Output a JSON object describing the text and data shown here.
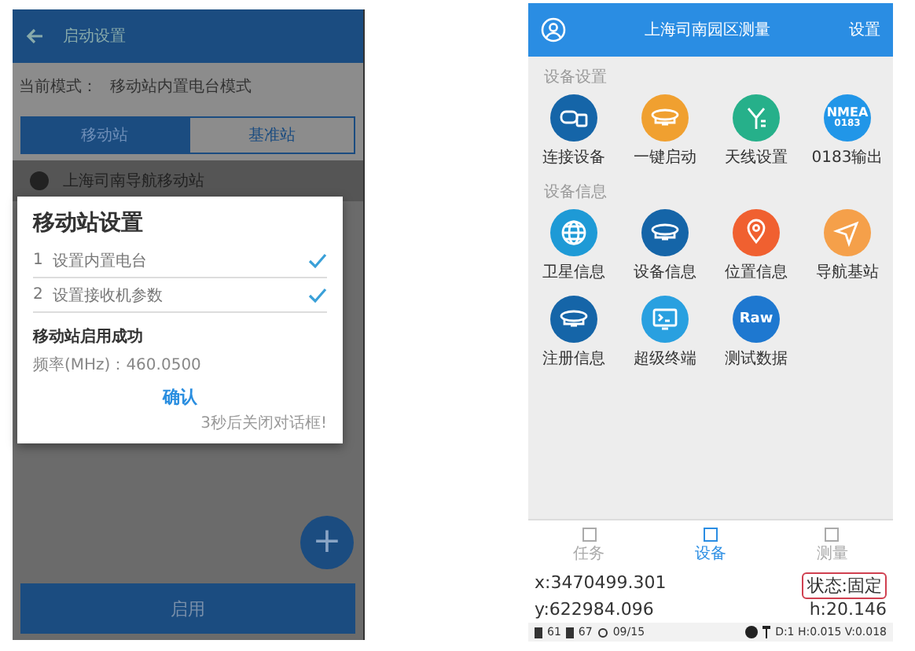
{
  "left_phone": {
    "title": "启动设置",
    "mode": {
      "label": "当前模式：",
      "value": "移动站内置电台模式"
    },
    "tabs": [
      {
        "label": "移动站",
        "selected": true
      },
      {
        "label": "基准站",
        "selected": false
      }
    ],
    "station": "上海司南导航移动站",
    "dialog": {
      "title": "移动站设置",
      "steps": [
        {
          "number": "1",
          "label": "设置内置电台",
          "checked": true
        },
        {
          "number": "2",
          "label": "设置接收机参数",
          "checked": true
        }
      ],
      "message": "移动站启用成功",
      "frequency": "频率(MHz)：460.0500",
      "confirm": "确认",
      "countdown": "3秒后关闭对话框!"
    },
    "fab": "+",
    "enable_button": "启用"
  },
  "right_phone": {
    "title": "上海司南园区测量",
    "settings": "设置",
    "sections": [
      {
        "title": "设备设置",
        "items": [
          {
            "label": "连接设备",
            "kind": "connect",
            "color": "#1565a8"
          },
          {
            "label": "一键启动",
            "kind": "receiver",
            "color": "#f0a030"
          },
          {
            "label": "天线设置",
            "kind": "antenna",
            "color": "#26b08a"
          },
          {
            "label": "0183输出",
            "kind": "text",
            "color": "#2196e8",
            "icon_text": [
              "NMEA",
              "0183"
            ]
          }
        ]
      },
      {
        "title": "设备信息",
        "items": [
          {
            "label": "卫星信息",
            "kind": "globe",
            "color": "#1e9ad6"
          },
          {
            "label": "设备信息",
            "kind": "receiver",
            "color": "#1565a8"
          },
          {
            "label": "位置信息",
            "kind": "pin",
            "color": "#f06030"
          },
          {
            "label": "导航基站",
            "kind": "navigate",
            "color": "#f5a04a"
          },
          {
            "label": "注册信息",
            "kind": "receiver",
            "color": "#1565a8"
          },
          {
            "label": "超级终端",
            "kind": "terminal",
            "color": "#29a0e0"
          },
          {
            "label": "测试数据",
            "kind": "text",
            "color": "#1e78d0",
            "icon_text": [
              "Raw"
            ]
          }
        ]
      }
    ],
    "nav": [
      {
        "label": "任务",
        "selected": false
      },
      {
        "label": "设备",
        "selected": true
      },
      {
        "label": "测量",
        "selected": false
      }
    ],
    "x": "x:3470499.301",
    "status": "状态:固定",
    "y": "y:622984.096",
    "h": "h:20.146",
    "status_bar": {
      "battery_1": "61",
      "battery_2": "67",
      "satellites": "09/15",
      "precision": "D:1 H:0.015 V:0.018"
    }
  }
}
